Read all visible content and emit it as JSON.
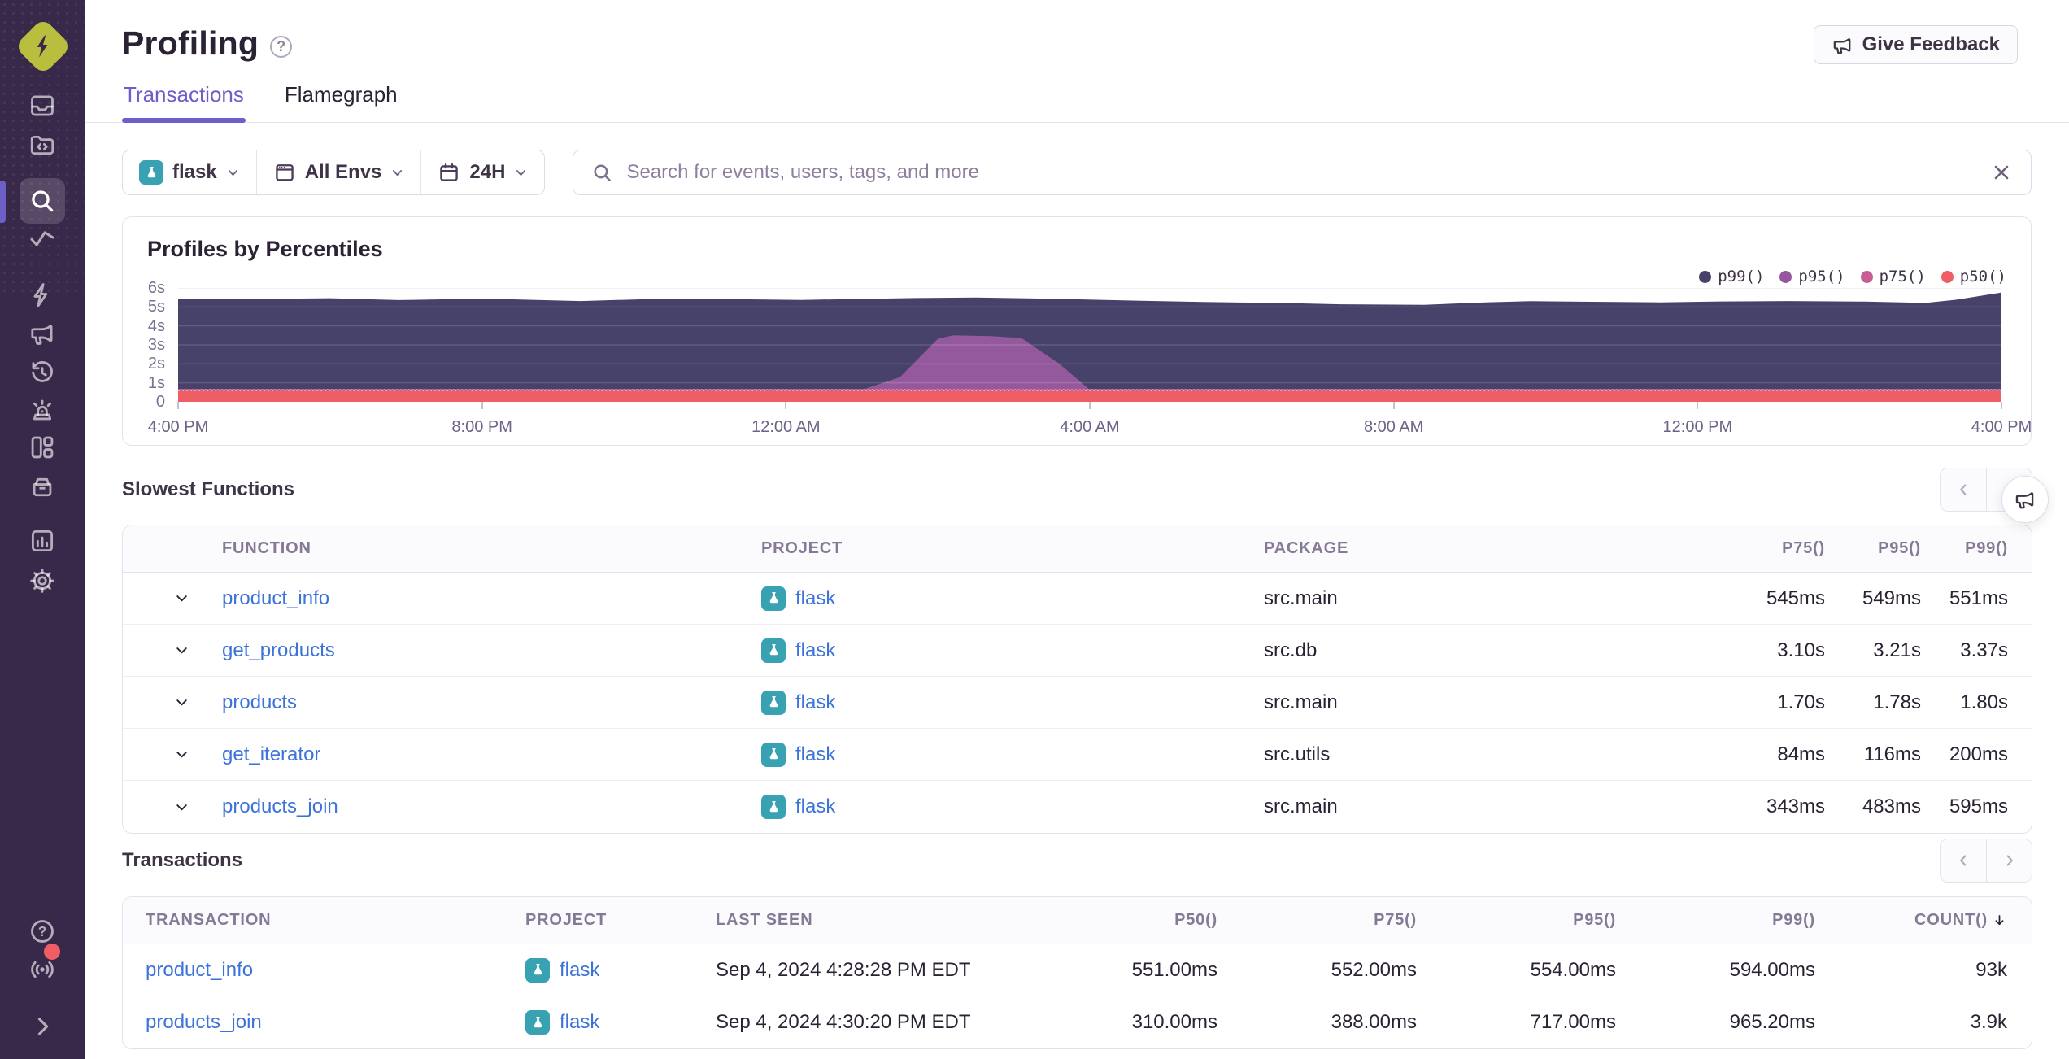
{
  "colors": {
    "sidebar_bg": "#38284a",
    "accent_purple": "#6c5fc7",
    "link_blue": "#3c73da",
    "border": "#e6e0ec",
    "muted_text": "#857a95",
    "text": "#2b2233",
    "logo_yellow": "#b9be3f",
    "project_teal": "#39a2b2",
    "notification_red": "#ef5e64",
    "p99": "#464269",
    "p95": "#94599c",
    "p75": "#c75d90",
    "p50": "#ee5e64"
  },
  "sidebar": {
    "icons": [
      "sentry-logo",
      "issues",
      "projects",
      "explore",
      "metrics",
      "lightning",
      "feedback-megaphone",
      "replays-history",
      "alerts-siren",
      "dashboards",
      "releases",
      "stats",
      "settings-gear"
    ],
    "active_icon": "explore",
    "bottom_icons": [
      "help",
      "whats-new-broadcast",
      "expand-chevron"
    ]
  },
  "header": {
    "title": "Profiling",
    "feedback_label": "Give Feedback"
  },
  "tabs": [
    {
      "label": "Transactions",
      "active": true
    },
    {
      "label": "Flamegraph",
      "active": false
    }
  ],
  "filters": {
    "project": "flask",
    "environment": "All Envs",
    "date_range": "24H",
    "search_placeholder": "Search for events, users, tags, and more"
  },
  "chart_data": {
    "type": "area",
    "title": "Profiles by Percentiles",
    "legend": [
      "p99()",
      "p95()",
      "p75()",
      "p50()"
    ],
    "legend_position": "top-right",
    "grid": true,
    "ylim": [
      0,
      6
    ],
    "y_unit": "seconds",
    "ylabel_ticks": [
      "6s",
      "5s",
      "4s",
      "3s",
      "2s",
      "1s",
      "0"
    ],
    "x_ticks": [
      "4:00 PM",
      "8:00 PM",
      "12:00 AM",
      "4:00 AM",
      "8:00 AM",
      "12:00 PM",
      "4:00 PM"
    ],
    "x_range_hours": [
      0,
      24
    ],
    "series": [
      {
        "name": "p99()",
        "color": "#464269",
        "points": [
          [
            0,
            5.4
          ],
          [
            1,
            5.42
          ],
          [
            2,
            5.46
          ],
          [
            2.9,
            5.36
          ],
          [
            4,
            5.44
          ],
          [
            5.3,
            5.31
          ],
          [
            6.4,
            5.44
          ],
          [
            7.3,
            5.41
          ],
          [
            8.2,
            5.37
          ],
          [
            9,
            5.42
          ],
          [
            9.7,
            5.47
          ],
          [
            10.5,
            5.5
          ],
          [
            11.5,
            5.43
          ],
          [
            12.5,
            5.34
          ],
          [
            13.5,
            5.26
          ],
          [
            14.5,
            5.21
          ],
          [
            15.3,
            5.14
          ],
          [
            16.4,
            5.11
          ],
          [
            17.2,
            5.24
          ],
          [
            17.8,
            5.3
          ],
          [
            18.6,
            5.27
          ],
          [
            19.5,
            5.24
          ],
          [
            20.3,
            5.29
          ],
          [
            21.2,
            5.31
          ],
          [
            22.2,
            5.28
          ],
          [
            23.0,
            5.21
          ],
          [
            23.4,
            5.38
          ],
          [
            24,
            5.76
          ]
        ]
      },
      {
        "name": "p95()",
        "color": "#94599c",
        "points": [
          [
            0,
            0.63
          ],
          [
            9.0,
            0.63
          ],
          [
            9.5,
            1.3
          ],
          [
            10.0,
            3.32
          ],
          [
            10.2,
            3.5
          ],
          [
            10.7,
            3.46
          ],
          [
            11.1,
            3.36
          ],
          [
            11.6,
            2.0
          ],
          [
            12.0,
            0.63
          ],
          [
            24,
            0.63
          ]
        ]
      },
      {
        "name": "p75()",
        "color": "#c75d90",
        "pattern": "dotted",
        "points": [
          [
            0,
            0.68
          ],
          [
            24,
            0.68
          ]
        ]
      },
      {
        "name": "p50()",
        "color": "#ee5e64",
        "points": [
          [
            0,
            0.56
          ],
          [
            24,
            0.56
          ]
        ]
      }
    ]
  },
  "slowest_functions": {
    "title": "Slowest Functions",
    "columns": [
      "FUNCTION",
      "PROJECT",
      "PACKAGE",
      "P75()",
      "P95()",
      "P99()"
    ],
    "rows": [
      {
        "function": "product_info",
        "project": "flask",
        "package": "src.main",
        "p75": "545ms",
        "p95": "549ms",
        "p99": "551ms"
      },
      {
        "function": "get_products",
        "project": "flask",
        "package": "src.db",
        "p75": "3.10s",
        "p95": "3.21s",
        "p99": "3.37s"
      },
      {
        "function": "products",
        "project": "flask",
        "package": "src.main",
        "p75": "1.70s",
        "p95": "1.78s",
        "p99": "1.80s"
      },
      {
        "function": "get_iterator",
        "project": "flask",
        "package": "src.utils",
        "p75": "84ms",
        "p95": "116ms",
        "p99": "200ms"
      },
      {
        "function": "products_join",
        "project": "flask",
        "package": "src.main",
        "p75": "343ms",
        "p95": "483ms",
        "p99": "595ms"
      }
    ]
  },
  "transactions": {
    "title": "Transactions",
    "columns": [
      "TRANSACTION",
      "PROJECT",
      "LAST SEEN",
      "P50()",
      "P75()",
      "P95()",
      "P99()",
      "COUNT()"
    ],
    "sorted_by": "COUNT()",
    "sort_direction": "desc",
    "rows": [
      {
        "transaction": "product_info",
        "project": "flask",
        "last_seen": "Sep 4, 2024 4:28:28 PM EDT",
        "p50": "551.00ms",
        "p75": "552.00ms",
        "p95": "554.00ms",
        "p99": "594.00ms",
        "count": "93k"
      },
      {
        "transaction": "products_join",
        "project": "flask",
        "last_seen": "Sep 4, 2024 4:30:20 PM EDT",
        "p50": "310.00ms",
        "p75": "388.00ms",
        "p95": "717.00ms",
        "p99": "965.20ms",
        "count": "3.9k"
      }
    ]
  }
}
